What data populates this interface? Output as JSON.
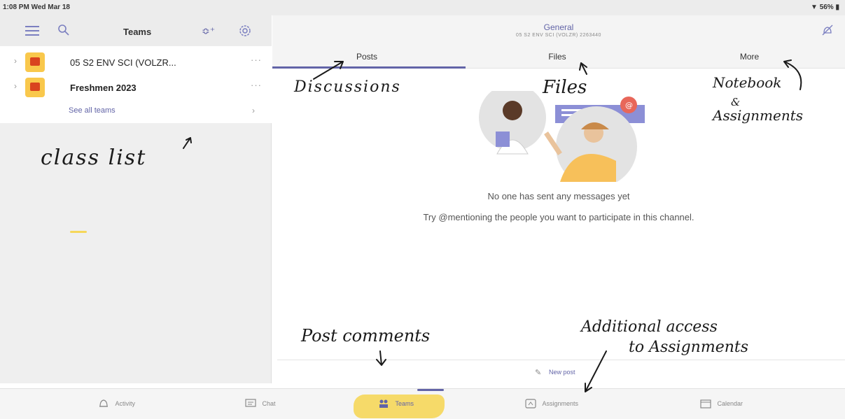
{
  "status_bar": {
    "time": "1:08 PM  Wed Mar 18",
    "right": "56%"
  },
  "sidebar": {
    "title": "Teams",
    "teams": [
      {
        "name": "05 S2 ENV SCI (VOLZR...",
        "more": "···"
      },
      {
        "name": "Freshmen 2023",
        "more": "···"
      }
    ],
    "see_all": "See all teams"
  },
  "channel": {
    "title": "General",
    "subtitle": "05 S2 ENV SCI (VOLZR) 2263440"
  },
  "tabs": {
    "posts": "Posts",
    "files": "Files",
    "more": "More"
  },
  "empty_state": {
    "title": "No one has sent any messages yet",
    "subtitle": "Try @mentioning the people you want to participate in this channel."
  },
  "compose": {
    "new_post": "New post"
  },
  "bottom_nav": {
    "activity": "Activity",
    "chat": "Chat",
    "teams": "Teams",
    "assignments": "Assignments",
    "calendar": "Calendar"
  },
  "annotations": {
    "class_list": "class list",
    "discussions": "Discussions",
    "files": "Files",
    "notebook": "Notebook",
    "and": "&",
    "assignments": "Assignments",
    "post_comments": "Post comments",
    "additional": "Additional access",
    "to_assignments": "to Assignments"
  },
  "colors": {
    "accent": "#6264a7",
    "highlight": "#f6d75a",
    "team_avatar": "#f9c84c"
  }
}
